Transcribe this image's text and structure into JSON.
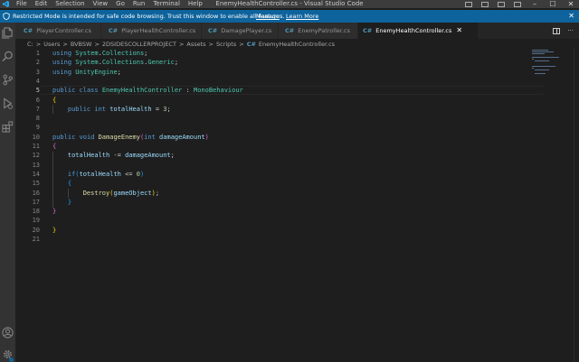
{
  "window": {
    "title": "EnemyHealthController.cs - Visual Studio Code",
    "menu": [
      "File",
      "Edit",
      "Selection",
      "View",
      "Go",
      "Run",
      "Terminal",
      "Help"
    ],
    "controls": {
      "minimize": "–",
      "maximize": "☐",
      "close": "✕"
    }
  },
  "banner": {
    "message": "Restricted Mode is intended for safe code browsing. Trust this window to enable all features.",
    "manage": "Manage",
    "learn_more": "Learn More",
    "close": "✕",
    "background": "#0e639c"
  },
  "tabs": [
    {
      "label": "PlayerController.cs",
      "icon": "C#"
    },
    {
      "label": "PlayerHealthController.cs",
      "icon": "C#"
    },
    {
      "label": "DamagePlayer.cs",
      "icon": "C#"
    },
    {
      "label": "EnemyPatroller.cs",
      "icon": "C#"
    },
    {
      "label": "EnemyHealthController.cs",
      "icon": "C#",
      "active": true,
      "close": "✕"
    }
  ],
  "tab_actions": {
    "more": "···"
  },
  "breadcrumb": {
    "parts": [
      "C:",
      "Users",
      "BVBSW",
      "2DSIDESCOLLERPROJECT",
      "Assets",
      "Scripts"
    ],
    "separator": ">",
    "file_icon": "C#",
    "file": "EnemyHealthController.cs"
  },
  "editor": {
    "line_numbers": [
      "1",
      "2",
      "3",
      "4",
      "5",
      "6",
      "7",
      "8",
      "9",
      "10",
      "11",
      "12",
      "13",
      "14",
      "15",
      "16",
      "17",
      "18",
      "19",
      "20",
      "21"
    ],
    "current_line": 5,
    "lines": [
      [
        [
          "k",
          "using"
        ],
        [
          "p",
          " "
        ],
        [
          "t",
          "System"
        ],
        [
          "p",
          "."
        ],
        [
          "t",
          "Collections"
        ],
        [
          "p",
          ";"
        ]
      ],
      [
        [
          "k",
          "using"
        ],
        [
          "p",
          " "
        ],
        [
          "t",
          "System"
        ],
        [
          "p",
          "."
        ],
        [
          "t",
          "Collections"
        ],
        [
          "p",
          "."
        ],
        [
          "t",
          "Generic"
        ],
        [
          "p",
          ";"
        ]
      ],
      [
        [
          "k",
          "using"
        ],
        [
          "p",
          " "
        ],
        [
          "t",
          "UnityEngine"
        ],
        [
          "p",
          ";"
        ]
      ],
      [],
      [
        [
          "k",
          "public"
        ],
        [
          "p",
          " "
        ],
        [
          "k",
          "class"
        ],
        [
          "p",
          " "
        ],
        [
          "t",
          "EnemyHealthController"
        ],
        [
          "p",
          " : "
        ],
        [
          "t",
          "MonoBehaviour"
        ]
      ],
      [
        [
          "b1",
          "{"
        ]
      ],
      [
        [
          "p",
          "    "
        ],
        [
          "k",
          "public"
        ],
        [
          "p",
          " "
        ],
        [
          "k",
          "int"
        ],
        [
          "p",
          " "
        ],
        [
          "v",
          "totalHealth"
        ],
        [
          "p",
          " = "
        ],
        [
          "n",
          "3"
        ],
        [
          "p",
          ";"
        ]
      ],
      [],
      [],
      [
        [
          "k",
          "public"
        ],
        [
          "p",
          " "
        ],
        [
          "k",
          "void"
        ],
        [
          "p",
          " "
        ],
        [
          "f",
          "DamageEnemy"
        ],
        [
          "b2",
          "("
        ],
        [
          "k",
          "int"
        ],
        [
          "p",
          " "
        ],
        [
          "v",
          "damageAmount"
        ],
        [
          "b2",
          ")"
        ]
      ],
      [
        [
          "b2",
          "{"
        ]
      ],
      [
        [
          "p",
          "    "
        ],
        [
          "v",
          "totalHealth"
        ],
        [
          "p",
          " -= "
        ],
        [
          "v",
          "damageAmount"
        ],
        [
          "p",
          ";"
        ]
      ],
      [],
      [
        [
          "p",
          "    "
        ],
        [
          "k",
          "if"
        ],
        [
          "b3",
          "("
        ],
        [
          "v",
          "totalHealth"
        ],
        [
          "p",
          " <= "
        ],
        [
          "n",
          "0"
        ],
        [
          "b3",
          ")"
        ]
      ],
      [
        [
          "p",
          "    "
        ],
        [
          "b3",
          "{"
        ]
      ],
      [
        [
          "p",
          "        "
        ],
        [
          "f",
          "Destroy"
        ],
        [
          "b1",
          "("
        ],
        [
          "v",
          "gameObject"
        ],
        [
          "b1",
          ")"
        ],
        [
          "p",
          ";"
        ]
      ],
      [
        [
          "p",
          "    "
        ],
        [
          "b3",
          "}"
        ]
      ],
      [
        [
          "b2",
          "}"
        ]
      ],
      [],
      [
        [
          "b1",
          "}"
        ]
      ],
      []
    ]
  },
  "icons": {
    "logo": "vscode-logo-icon",
    "shield": "shield-icon",
    "activity": [
      "explorer-icon",
      "search-icon",
      "source-control-icon",
      "run-debug-icon",
      "extensions-icon",
      "account-icon",
      "gear-icon"
    ]
  },
  "colors": {
    "editor_bg": "#1e1e1e",
    "keyword": "#569cd6",
    "type": "#4ec9b0",
    "function": "#dcdcaa",
    "variable": "#9cdcfe",
    "number": "#b5cea8"
  }
}
